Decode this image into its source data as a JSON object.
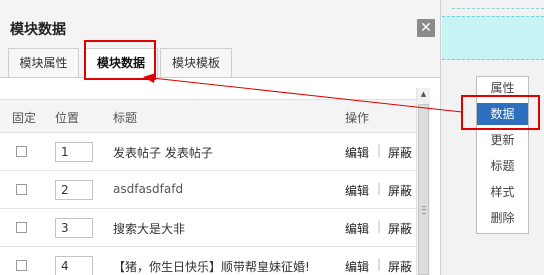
{
  "dialog": {
    "title": "模块数据",
    "close_icon": "✕",
    "tabs": [
      {
        "label": "模块属性"
      },
      {
        "label": "模块数据",
        "active": true
      },
      {
        "label": "模块模板"
      }
    ]
  },
  "table": {
    "headers": {
      "fixed": "固定",
      "position": "位置",
      "title": "标题",
      "actions": "操作"
    },
    "rows": [
      {
        "position": "1",
        "title": "发表帖子 发表帖子",
        "edit": "编辑",
        "sep": "|",
        "hide": "屏蔽"
      },
      {
        "position": "2",
        "title": "asdfasdfafd",
        "edit": "编辑",
        "sep": "|",
        "hide": "屏蔽"
      },
      {
        "position": "3",
        "title": "搜索大是大非",
        "edit": "编辑",
        "sep": "|",
        "hide": "屏蔽"
      },
      {
        "position": "4",
        "title": "【猪，你生日快乐】顺带帮皇妹征婚!",
        "edit": "编辑",
        "sep": "|",
        "hide": "屏蔽"
      }
    ]
  },
  "side_menu": {
    "items": [
      {
        "label": "属性"
      },
      {
        "label": "数据",
        "active": true
      },
      {
        "label": "更新"
      },
      {
        "label": "标题"
      },
      {
        "label": "样式"
      },
      {
        "label": "删除"
      }
    ]
  },
  "colors": {
    "highlight": "#e00000",
    "active_menu": "#2f6fc0"
  }
}
